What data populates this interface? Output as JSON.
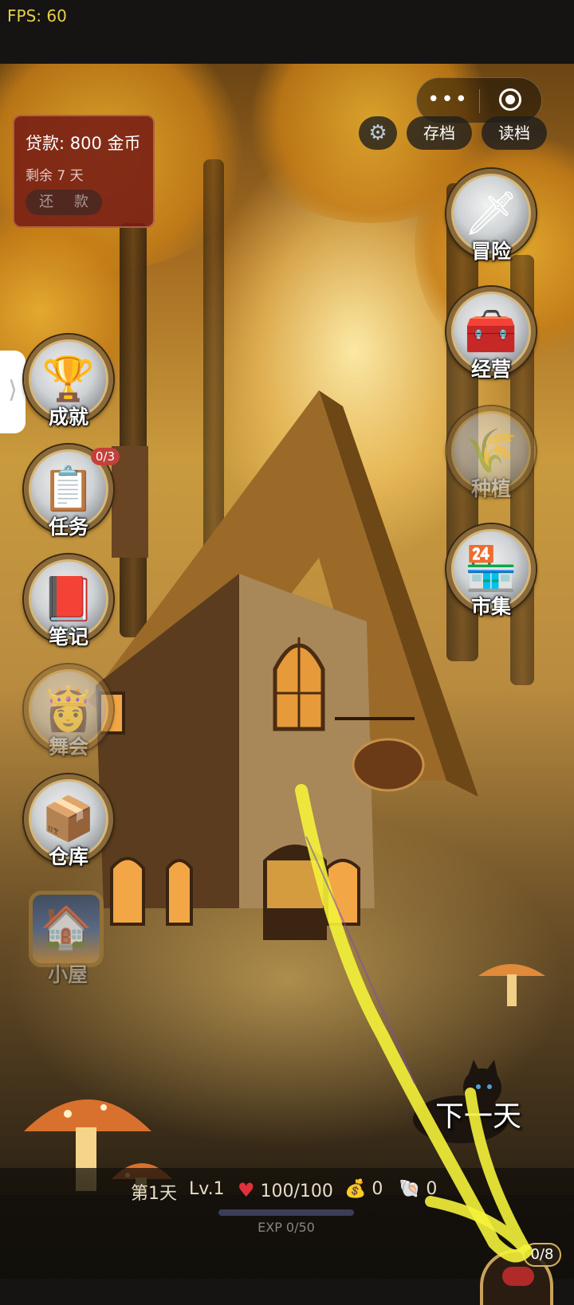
{
  "status_bar": {
    "fps": "FPS: 60"
  },
  "loan": {
    "amount": "贷款: 800 金币",
    "days_left": "剩余 7 天",
    "repay_label": "还 款"
  },
  "capsule": {
    "more_glyph": "•••"
  },
  "top_buttons": {
    "settings_glyph": "⚙",
    "save_label": "存档",
    "load_label": "读档"
  },
  "left_menu": [
    {
      "id": "achievements",
      "label": "成就",
      "icon": "trophy-icon",
      "glyph": "🏆",
      "locked": false
    },
    {
      "id": "tasks",
      "label": "任务",
      "icon": "clipboard-icon",
      "glyph": "📋",
      "locked": false,
      "badge": "0/3"
    },
    {
      "id": "notes",
      "label": "笔记",
      "icon": "book-icon",
      "glyph": "📕",
      "locked": false
    },
    {
      "id": "dance",
      "label": "舞会",
      "icon": "dancer-icon",
      "glyph": "👸",
      "locked": true
    },
    {
      "id": "storage",
      "label": "仓库",
      "icon": "box-icon",
      "glyph": "📦",
      "locked": false
    }
  ],
  "cabin": {
    "label": "小屋",
    "icon": "cabin-icon",
    "glyph": "🏠",
    "locked": true
  },
  "right_menu": [
    {
      "id": "adventure",
      "label": "冒险",
      "icon": "sword-icon",
      "glyph": "🗡",
      "locked": false
    },
    {
      "id": "business",
      "label": "经营",
      "icon": "cash-register-icon",
      "glyph": "🧰",
      "locked": false
    },
    {
      "id": "farming",
      "label": "种植",
      "icon": "farm-icon",
      "glyph": "🌾",
      "locked": true
    },
    {
      "id": "market",
      "label": "市集",
      "icon": "shop-icon",
      "glyph": "🏪",
      "locked": false
    }
  ],
  "next_day": {
    "label": "下一天"
  },
  "hud": {
    "day": "第1天",
    "level": "Lv.1",
    "hp": "100/100",
    "coins": "0",
    "shells": "0",
    "exp_text": "EXP 0/50",
    "exp_fraction": 0.0
  },
  "bag": {
    "counter": "0/8"
  },
  "colors": {
    "loan_bg": "#761c14",
    "hp_heart": "#e0323c",
    "highlight_stroke": "#f4f23a"
  }
}
